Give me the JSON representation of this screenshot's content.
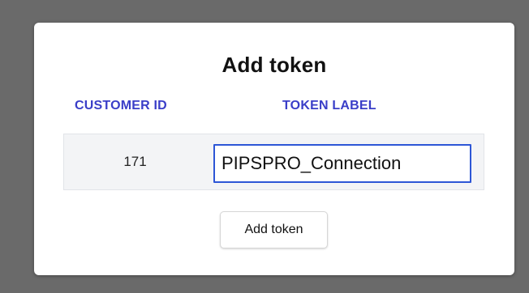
{
  "modal": {
    "title": "Add token"
  },
  "table": {
    "headers": {
      "customer_id": "CUSTOMER ID",
      "token_label": "TOKEN LABEL"
    },
    "row": {
      "customer_id": "171",
      "token_label_value": "PIPSPRO_Connection"
    }
  },
  "actions": {
    "add_token_label": "Add token"
  },
  "colors": {
    "header_text": "#3a3ec8",
    "input_focus_border": "#2d56d6",
    "row_background": "#f3f4f6",
    "backdrop": "#6a6a6a"
  }
}
